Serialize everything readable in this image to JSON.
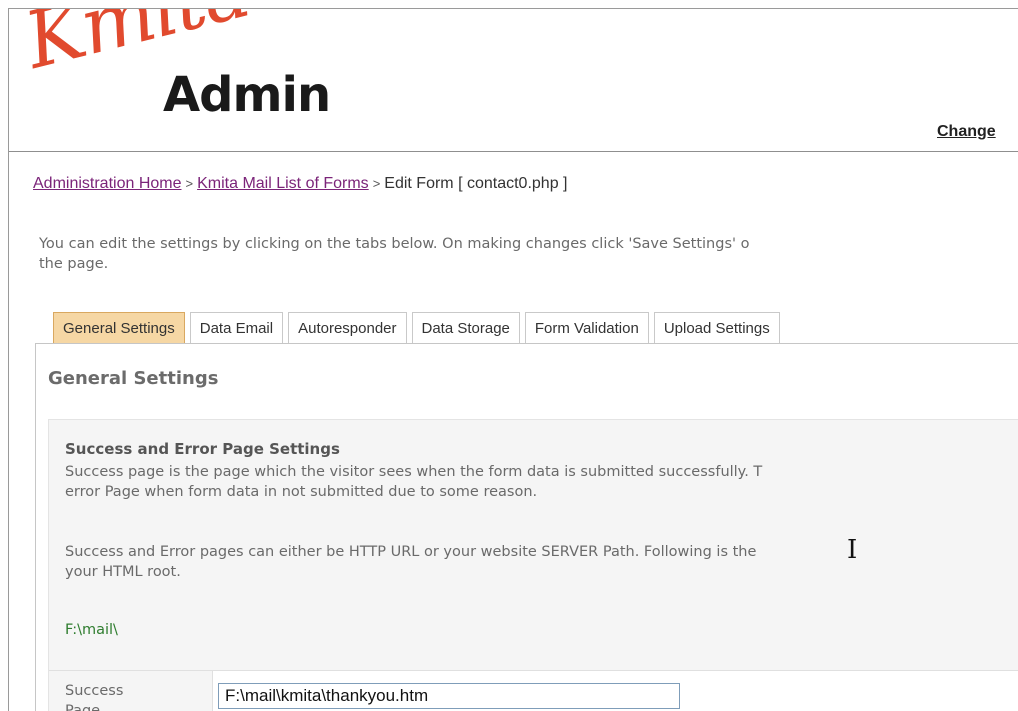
{
  "header": {
    "logo_script": "Kmita",
    "logo_admin": "Admin",
    "change_link": "Change"
  },
  "breadcrumb": {
    "home": "Administration Home",
    "separator": ">",
    "forms": "Kmita Mail List of Forms",
    "current": "Edit Form [ contact0.php ]"
  },
  "intro": {
    "line1": "You can edit the settings by clicking on the tabs below. On making changes click 'Save Settings' o",
    "line2": "the page."
  },
  "tabs": [
    {
      "label": "General Settings",
      "active": true
    },
    {
      "label": "Data Email",
      "active": false
    },
    {
      "label": "Autoresponder",
      "active": false
    },
    {
      "label": "Data Storage",
      "active": false
    },
    {
      "label": "Form Validation",
      "active": false
    },
    {
      "label": "Upload Settings",
      "active": false
    }
  ],
  "panel": {
    "title": "General Settings",
    "section": {
      "title": "Success and Error Page Settings",
      "para1_line1": "Success page is the page which the visitor sees when the form data is submitted successfully. T",
      "para1_line2": "error Page when form data in not submitted due to some reason.",
      "para2_line1": "Success and Error pages can either be HTTP URL or your website SERVER Path. Following is the",
      "para2_line2": "your HTML root.",
      "server_path": "F:\\mail\\",
      "success_label_line1": "Success",
      "success_label_line2": "Page",
      "success_value": "F:\\mail\\kmita\\thankyou.htm"
    }
  },
  "colors": {
    "active_tab_bg": "#f6d7a4",
    "link_color": "#7b2479",
    "path_color": "#2f7d2f",
    "logo_red": "#e14a2e"
  }
}
